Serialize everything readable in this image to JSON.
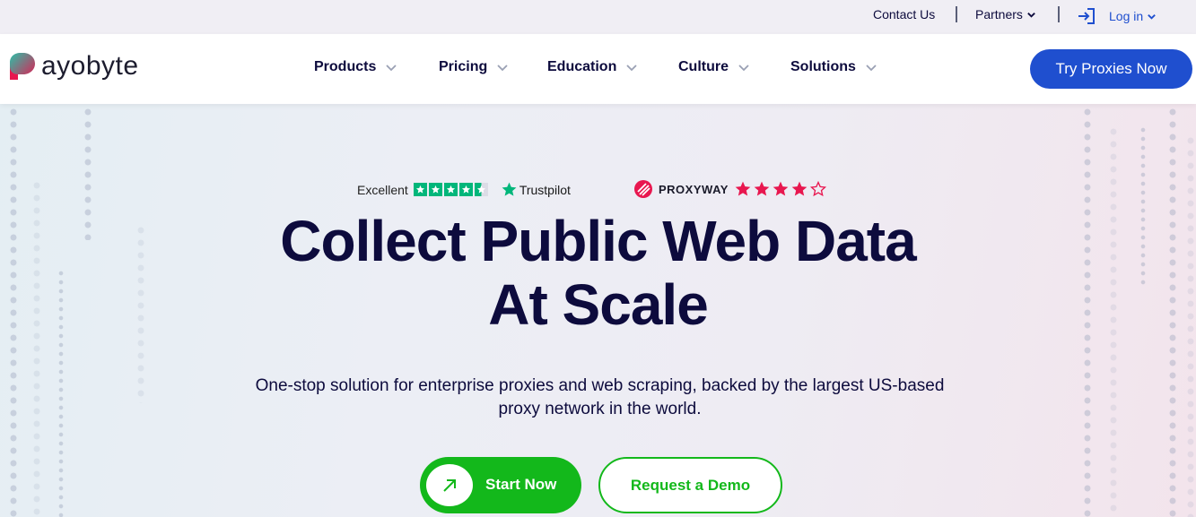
{
  "topbar": {
    "contact": "Contact Us",
    "partners": "Partners",
    "login": "Log in"
  },
  "header": {
    "logo_text": "ayobyte",
    "nav": [
      {
        "label": "Products"
      },
      {
        "label": "Pricing"
      },
      {
        "label": "Education"
      },
      {
        "label": "Culture"
      },
      {
        "label": "Solutions"
      }
    ],
    "cta": "Try Proxies Now"
  },
  "ratings": {
    "trustpilot": {
      "label": "Excellent",
      "brand": "Trustpilot",
      "stars": 4.5
    },
    "proxyway": {
      "brand": "PROXYWAY",
      "stars": 4,
      "max": 5
    }
  },
  "hero": {
    "title_line1": "Collect Public Web Data",
    "title_line2": "At Scale",
    "subtitle_line1": "One-stop solution for enterprise proxies and web scraping, backed by the largest US-based",
    "subtitle_line2": "proxy network in the world.",
    "primary_cta": "Start Now",
    "secondary_cta": "Request a Demo"
  },
  "colors": {
    "brand_blue": "#1f4fcf",
    "green": "#13b81b",
    "trustpilot_green": "#00b67a",
    "proxyway_red": "#e8174f",
    "text_dark": "#0d0b3d"
  }
}
